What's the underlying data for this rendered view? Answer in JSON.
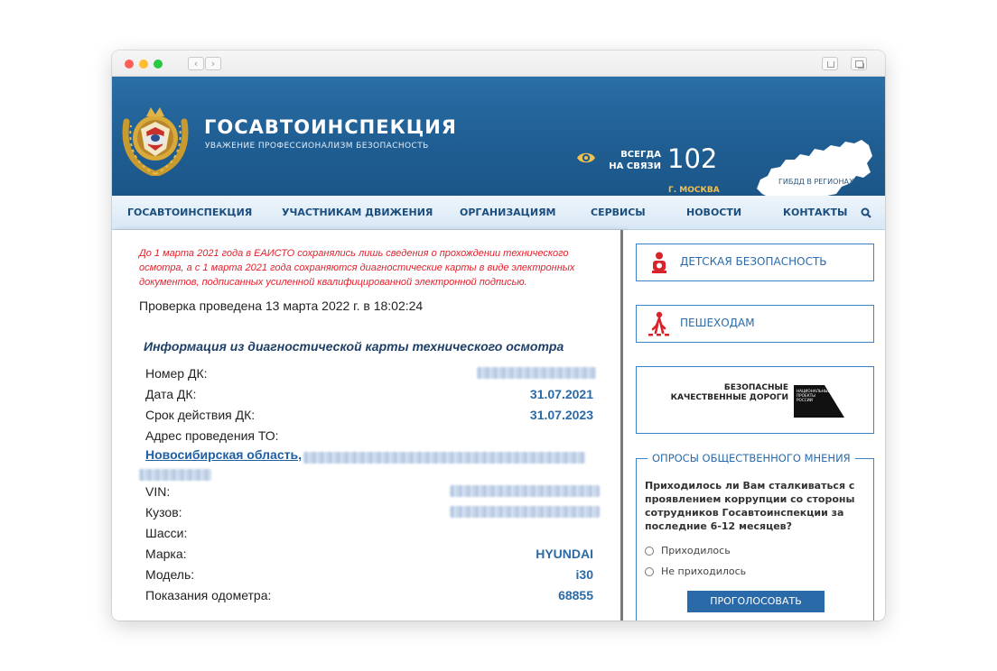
{
  "header": {
    "title": "ГОСАВТОИНСПЕКЦИЯ",
    "subtitle": "УВАЖЕНИЕ ПРОФЕССИОНАЛИЗМ БЕЗОПАСНОСТЬ",
    "always_line1": "ВСЕГДА",
    "always_line2": "НА СВЯЗИ",
    "phone": "102",
    "city": "Г. МОСКВА",
    "regions_label": "ГИБДД В РЕГИОНАХ"
  },
  "nav": {
    "items": [
      "ГОСАВТОИНСПЕКЦИЯ",
      "УЧАСТНИКАМ ДВИЖЕНИЯ",
      "ОРГАНИЗАЦИЯМ",
      "СЕРВИСЫ",
      "НОВОСТИ",
      "КОНТАКТЫ"
    ]
  },
  "content": {
    "notice_lines": [
      "До 1 марта 2021 года в ЕАИСТО сохранялись лишь сведения о прохождении технического",
      "осмотра, а с 1 марта 2021 года сохраняются диагностические карты в виде электронных",
      "документов, подписанных усиленной квалифицированной электронной подписью."
    ],
    "checked": "Проверка проведена 13 марта 2022 г. в 18:02:24",
    "info_title": "Информация из диагностической карты технического осмотра",
    "rows": [
      {
        "label": "Номер ДК:",
        "value": ""
      },
      {
        "label": "Дата ДК:",
        "value": "31.07.2021"
      },
      {
        "label": "Срок действия ДК:",
        "value": "31.07.2023"
      },
      {
        "label": "Адрес проведения ТО:",
        "value": ""
      },
      {
        "label": "VIN:",
        "value": ""
      },
      {
        "label": "Кузов:",
        "value": ""
      },
      {
        "label": "Шасси:",
        "value": ""
      },
      {
        "label": "Марка:",
        "value": "HYUNDAI"
      },
      {
        "label": "Модель:",
        "value": "i30"
      },
      {
        "label": "Показания одометра:",
        "value": "68855"
      }
    ],
    "address_link": "Новосибирская область,"
  },
  "sidebar": {
    "child_safety": "ДЕТСКАЯ БЕЗОПАСНОСТЬ",
    "pedestrians": "ПЕШЕХОДАМ",
    "roads_line1": "БЕЗОПАСНЫЕ",
    "roads_line2": "КАЧЕСТВЕННЫЕ ДОРОГИ",
    "roads_logo_text": "НАЦИОНАЛЬНЫЕ ПРОЕКТЫ РОССИИ",
    "poll_legend": "ОПРОСЫ ОБЩЕСТВЕННОГО МНЕНИЯ",
    "poll_question": "Приходилось ли Вам сталкиваться с проявлением коррупции со стороны сотрудников Госавтоинспекции за последние 6-12 месяцев?",
    "option_yes": "Приходилось",
    "option_no": "Не приходилось",
    "vote_button": "ПРОГОЛОСОВАТЬ"
  },
  "colors": {
    "header_blue": "#1f5e93",
    "link_blue": "#2b6aa6",
    "notice_red": "#e2202c",
    "accent_gold": "#f2c14e",
    "sidebar_red": "#d8232a"
  },
  "icons": [
    "eye-icon",
    "search-icon",
    "child-safety-icon",
    "pedestrian-icon",
    "russia-map-icon",
    "emblem-icon"
  ]
}
